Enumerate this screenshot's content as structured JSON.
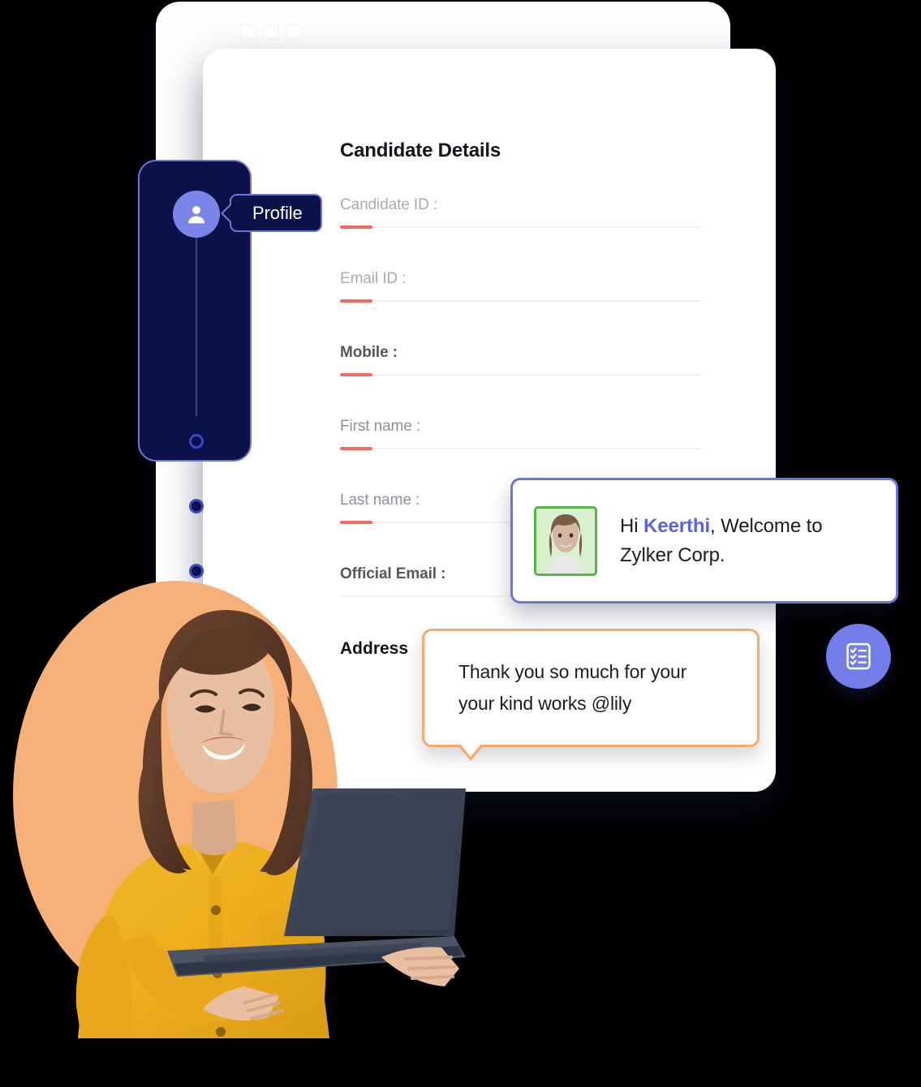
{
  "window": {
    "controls": [
      "minimize-dot",
      "maximize-dot",
      "close-dot"
    ]
  },
  "form": {
    "title": "Candidate Details",
    "fields": [
      {
        "label": "Candidate ID :",
        "tone": "light",
        "accent": true
      },
      {
        "label": "Email ID :",
        "tone": "light",
        "accent": true
      },
      {
        "label": "Mobile :",
        "tone": "dark",
        "accent": true
      },
      {
        "label": "First name :",
        "tone": "mid",
        "accent": true
      },
      {
        "label": "Last name :",
        "tone": "mid",
        "accent": true
      },
      {
        "label": "Official Email :",
        "tone": "dark",
        "accent": false
      }
    ],
    "address_label": "Address"
  },
  "sidebar": {
    "avatar_icon": "user-icon",
    "steps": [
      "step-dot-1",
      "step-dot-2",
      "step-dot-3"
    ],
    "tooltip": {
      "label": "Profile"
    }
  },
  "welcome_bubble": {
    "greeting": "Hi ",
    "name": "Keerthi",
    "rest": ", Welcome to Zylker Corp.",
    "avatar_icon": "employee-photo"
  },
  "thanks_bubble": {
    "text": "Thank you so much for your your kind works @lily"
  },
  "fab": {
    "icon": "checklist-icon"
  },
  "colors": {
    "accent_red": "#f26a62",
    "brand_purple": "#6b76dd",
    "navy": "#0b1248",
    "orange": "#f7b077",
    "bubble_orange": "#f5ab6b",
    "avatar_green": "#55b64a"
  }
}
